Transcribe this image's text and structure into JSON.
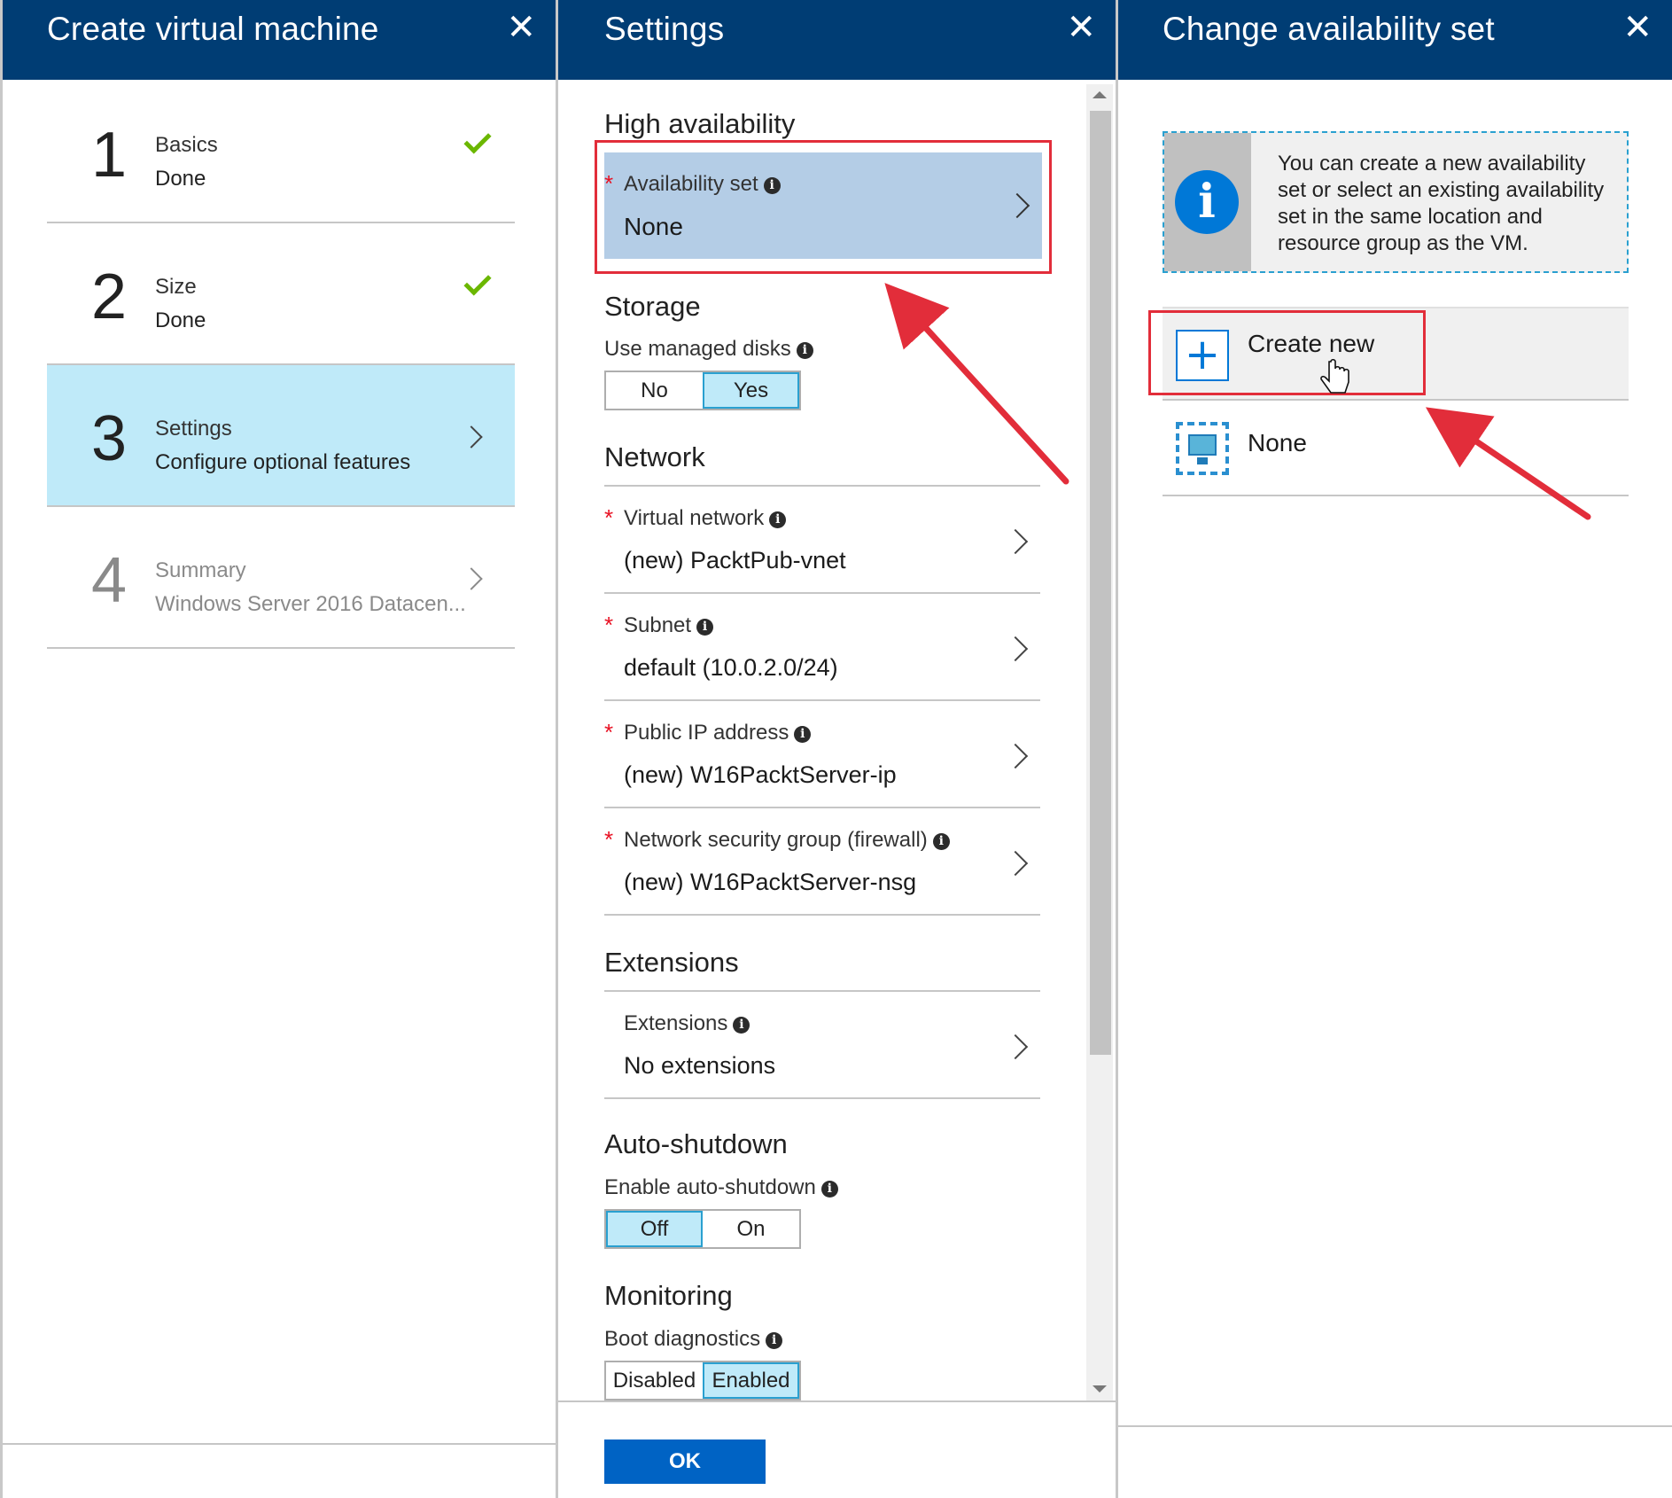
{
  "panels": {
    "create_vm": {
      "title": "Create virtual machine",
      "steps": [
        {
          "number": "1",
          "name": "Basics",
          "desc": "Done",
          "state": "done"
        },
        {
          "number": "2",
          "name": "Size",
          "desc": "Done",
          "state": "done"
        },
        {
          "number": "3",
          "name": "Settings",
          "desc": "Configure optional features",
          "state": "active"
        },
        {
          "number": "4",
          "name": "Summary",
          "desc": "Windows Server 2016 Datacen...",
          "state": "disabled"
        }
      ]
    },
    "settings": {
      "title": "Settings",
      "high_availability": {
        "title": "High availability",
        "availability_set": {
          "label": "Availability set",
          "value": "None"
        }
      },
      "storage": {
        "title": "Storage",
        "managed_disks_label": "Use managed disks",
        "options": [
          "No",
          "Yes"
        ],
        "selected": "Yes"
      },
      "network": {
        "title": "Network",
        "rows": [
          {
            "label": "Virtual network",
            "value": "(new) PacktPub-vnet"
          },
          {
            "label": "Subnet",
            "value": "default (10.0.2.0/24)"
          },
          {
            "label": "Public IP address",
            "value": "(new) W16PacktServer-ip"
          },
          {
            "label": "Network security group (firewall)",
            "value": "(new) W16PacktServer-nsg"
          }
        ]
      },
      "extensions": {
        "title": "Extensions",
        "label": "Extensions",
        "value": "No extensions"
      },
      "auto_shutdown": {
        "title": "Auto-shutdown",
        "label": "Enable auto-shutdown",
        "options": [
          "Off",
          "On"
        ],
        "selected": "Off"
      },
      "monitoring": {
        "title": "Monitoring",
        "label": "Boot diagnostics",
        "options": [
          "Disabled",
          "Enabled"
        ],
        "selected": "Enabled"
      },
      "ok_label": "OK"
    },
    "availability_set": {
      "title": "Change availability set",
      "info_text": "You can create a new availability set or select an existing availability set in the same location and resource group as the VM.",
      "items": [
        {
          "label": "Create new",
          "icon": "plus-icon"
        },
        {
          "label": "None",
          "icon": "availability-set-icon"
        }
      ]
    }
  },
  "icons": {
    "close": "✕",
    "info": "i",
    "required": "*"
  },
  "colors": {
    "header": "#003d74",
    "selected": "#bfeaf9",
    "highlight_row": "#b4cde6",
    "callout_red": "#e22d3a",
    "checkmark": "#6bb700",
    "primary_button": "#0063c4"
  }
}
